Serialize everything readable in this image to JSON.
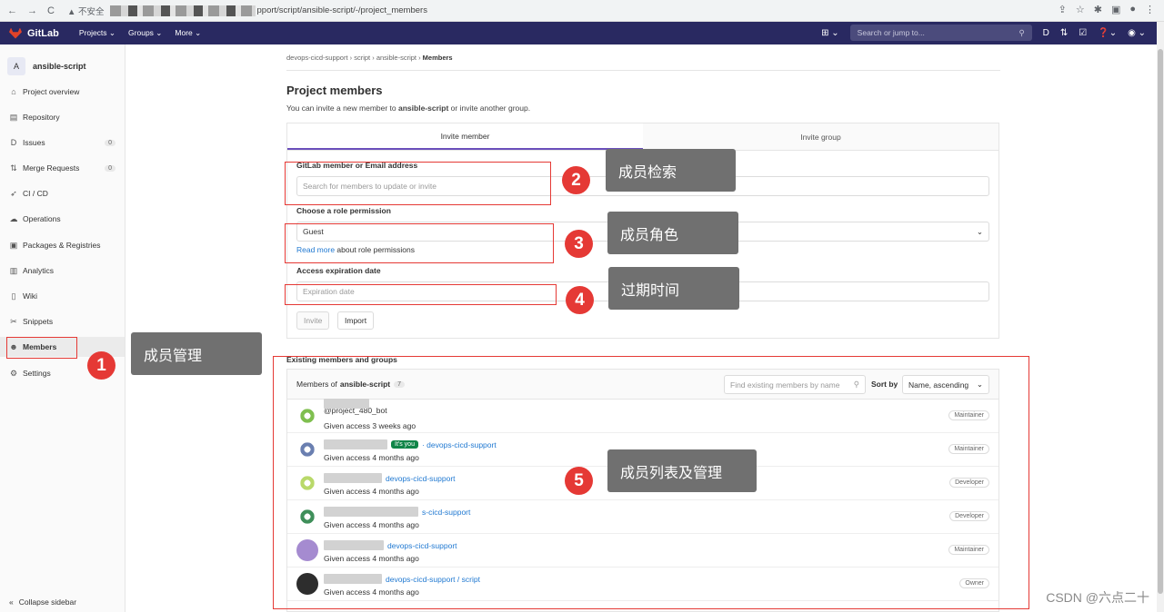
{
  "browser": {
    "insecure_label": "不安全",
    "url_visible": "pport/script/ansible-script/-/project_members"
  },
  "topnav": {
    "brand": "GitLab",
    "menu": [
      "Projects",
      "Groups",
      "More"
    ],
    "search_placeholder": "Search or jump to..."
  },
  "sidebar": {
    "project_initial": "A",
    "project_name": "ansible-script",
    "items": [
      {
        "label": "Project overview",
        "icon": "home-icon"
      },
      {
        "label": "Repository",
        "icon": "book-icon"
      },
      {
        "label": "Issues",
        "icon": "issues-icon",
        "count": "0"
      },
      {
        "label": "Merge Requests",
        "icon": "merge-request-icon",
        "count": "0"
      },
      {
        "label": "CI / CD",
        "icon": "rocket-icon"
      },
      {
        "label": "Operations",
        "icon": "cloud-gauge-icon"
      },
      {
        "label": "Packages & Registries",
        "icon": "package-icon"
      },
      {
        "label": "Analytics",
        "icon": "chart-icon"
      },
      {
        "label": "Wiki",
        "icon": "book-open-icon"
      },
      {
        "label": "Snippets",
        "icon": "scissors-icon"
      },
      {
        "label": "Members",
        "icon": "users-icon"
      },
      {
        "label": "Settings",
        "icon": "gear-icon"
      }
    ],
    "collapse_label": "Collapse sidebar"
  },
  "breadcrumb": [
    "devops-cicd-support",
    "script",
    "ansible-script",
    "Members"
  ],
  "page": {
    "title": "Project members",
    "subtitle_pre": "You can invite a new member to ",
    "subtitle_project": "ansible-script",
    "subtitle_post": " or invite another group."
  },
  "invite": {
    "tabs": [
      "Invite member",
      "Invite group"
    ],
    "member_label": "GitLab member or Email address",
    "member_placeholder": "Search for members to update or invite",
    "role_label": "Choose a role permission",
    "role_value": "Guest",
    "read_more_link": "Read more",
    "read_more_text": " about role permissions",
    "expiry_label": "Access expiration date",
    "expiry_placeholder": "Expiration date",
    "invite_button": "Invite",
    "import_button": "Import"
  },
  "members": {
    "section_label": "Existing members and groups",
    "header_prefix": "Members of",
    "project": "ansible-script",
    "count": "7",
    "search_placeholder": "Find existing members by name",
    "sort_label": "Sort by",
    "sort_value": "Name, ascending",
    "rows": [
      {
        "name": "@project_480_bot",
        "group": "",
        "given": "Given access 3 weeks ago",
        "role": "Maintainer",
        "you": "",
        "avatar_color": "#7fbf4f"
      },
      {
        "name": "",
        "group": "· devops-cicd-support",
        "given": "Given access 4 months ago",
        "role": "Maintainer",
        "you": "It's you",
        "avatar_color": "#6a7fb0"
      },
      {
        "name": "",
        "group": "devops-cicd-support",
        "given": "Given access 4 months ago",
        "role": "Developer",
        "you": "",
        "avatar_color": "#b9d96a"
      },
      {
        "name": "",
        "group": "s-cicd-support",
        "given": "Given access 4 months ago",
        "role": "Developer",
        "you": "",
        "avatar_color": "#3f8f5a"
      },
      {
        "name": "",
        "group": "devops-cicd-support",
        "given": "Given access 4 months ago",
        "role": "Maintainer",
        "you": "",
        "avatar_color": "#a58bd0"
      },
      {
        "name": "",
        "group": "devops-cicd-support / script",
        "given": "Given access 4 months ago",
        "role": "Owner",
        "you": "",
        "avatar_color": "#2d2d2d"
      }
    ]
  },
  "annotations": [
    {
      "num": "1",
      "text": "成员管理"
    },
    {
      "num": "2",
      "text": "成员检索"
    },
    {
      "num": "3",
      "text": "成员角色"
    },
    {
      "num": "4",
      "text": "过期时间"
    },
    {
      "num": "5",
      "text": "成员列表及管理"
    }
  ],
  "watermark": "CSDN @六点二十",
  "colors": {
    "nav": "#292961",
    "accent": "#1f78d1",
    "annotation_red": "#e53935",
    "callout_gray": "#707070"
  }
}
